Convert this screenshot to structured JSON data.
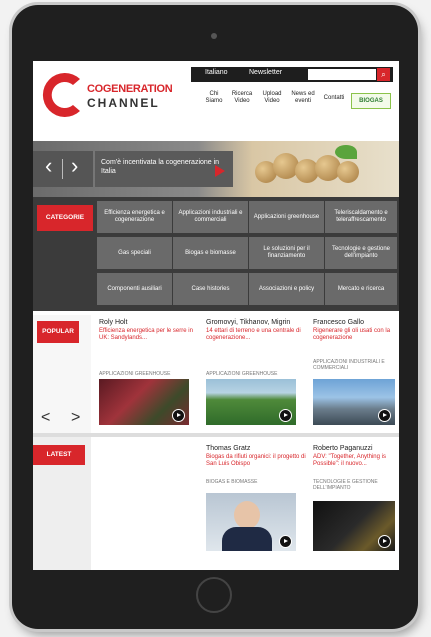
{
  "header": {
    "logo_line1": "COGENERATION",
    "logo_line2": "CHANNEL",
    "lang": [
      "Italiano",
      "Newsletter"
    ],
    "search_placeholder": "",
    "search_icon": "search-icon",
    "nav": [
      "Chi\nSiamo",
      "Ricerca\nVideo",
      "Upload\nVideo",
      "News ed\neventi",
      "Contatti"
    ],
    "partner": "BIOGAS"
  },
  "hero": {
    "caption": "Com'è incentivata la cogenerazione in Italia",
    "prev": "‹",
    "next": "›"
  },
  "categories": {
    "label": "CATEGORIE",
    "items": [
      "Efficienza energetica e cogenerazione",
      "Applicazioni industriali e commerciali",
      "Applicazioni greenhouse",
      "Teleriscaldamento e teleraffrescamento",
      "Gas speciali",
      "Biogas e biomasse",
      "Le soluzioni per il finanziamento",
      "Tecnologie e gestione dell'impianto",
      "Componenti ausiliari",
      "Case histories",
      "Associazioni e policy",
      "Mercato e ricerca"
    ]
  },
  "popular": {
    "label": "POPULAR",
    "prev": "<",
    "next": ">",
    "cards": [
      {
        "author": "Roly Holt",
        "title": "Efficienza energetica per le serre in UK: Sandylands...",
        "category": "APPLICAZIONI GREENHOUSE"
      },
      {
        "author": "Gromovyi, Tikhanov, Migrin",
        "title": "14 ettari di terreno e una centrale di cogenerazione...",
        "category": "APPLICAZIONI GREENHOUSE"
      },
      {
        "author": "Francesco Gallo",
        "title": "Rigenerare gli oli usati con la cogenerazione",
        "category": "APPLICAZIONI INDUSTRIALI E COMMERCIALI"
      }
    ]
  },
  "latest": {
    "label": "LATEST",
    "cards": [
      {
        "author": "Thomas Gratz",
        "title": "Biogas da rifiuti organici: il progetto di San Luis Obispo",
        "category": "BIOGAS E BIOMASSE"
      },
      {
        "author": "Roberto Paganuzzi",
        "title": "ADV: \"Together, Anything is Possible\": il nuovo...",
        "category": "TECNOLOGIE E GESTIONE DELL'IMPIANTO"
      }
    ]
  },
  "colors": {
    "accent": "#d8262b",
    "dark": "#3b3b3b",
    "cell": "#6a6a6a"
  }
}
